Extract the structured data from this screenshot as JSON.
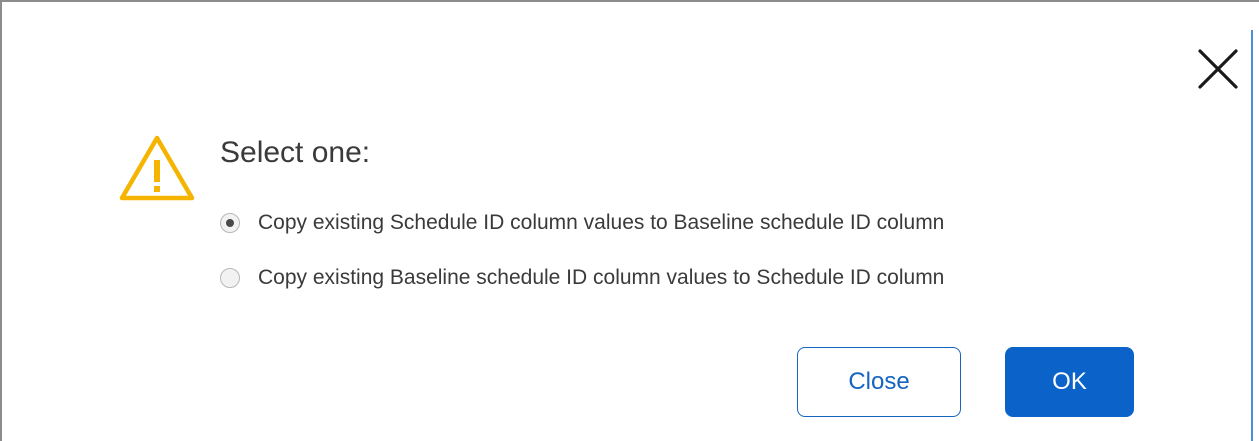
{
  "dialog": {
    "title": "Select one:",
    "icons": {
      "warning": "warning-triangle-icon",
      "close": "close-x-icon"
    },
    "options": [
      {
        "label": "Copy existing Schedule ID column values to Baseline schedule ID column",
        "selected": true
      },
      {
        "label": "Copy existing Baseline schedule ID column values to Schedule ID column",
        "selected": false
      }
    ],
    "buttons": {
      "close_label": "Close",
      "ok_label": "OK"
    },
    "colors": {
      "primary": "#0b63c9",
      "warning": "#f5b400",
      "text": "#3a3a3a"
    }
  }
}
